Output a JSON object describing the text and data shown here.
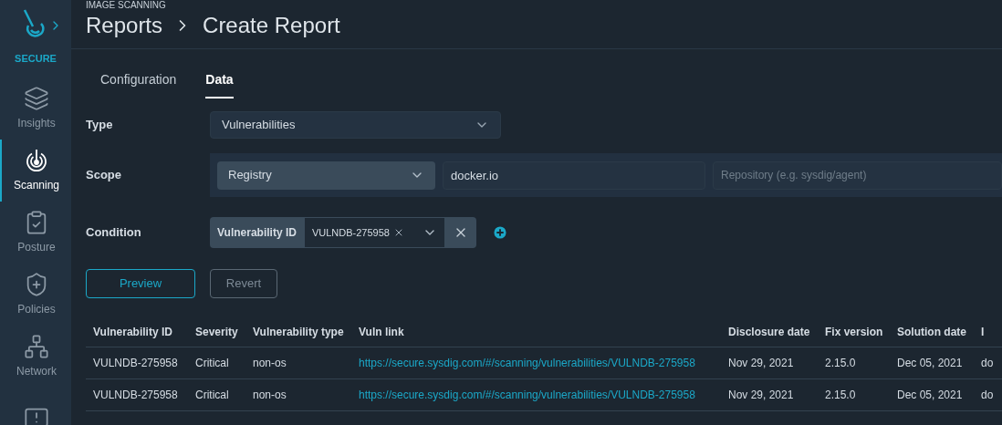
{
  "sidebar": {
    "brand": "SECURE",
    "items": [
      {
        "label": "Insights",
        "kind": "layers",
        "selected": false
      },
      {
        "label": "Scanning",
        "kind": "scan",
        "selected": true
      },
      {
        "label": "Posture",
        "kind": "clipboard",
        "selected": false
      },
      {
        "label": "Policies",
        "kind": "shield",
        "selected": false
      },
      {
        "label": "Network",
        "kind": "network",
        "selected": false
      },
      {
        "kind": "chat",
        "selected": false
      }
    ]
  },
  "header": {
    "section": "IMAGE SCANNING",
    "breadcrumb": [
      "Reports",
      "Create Report"
    ]
  },
  "tabs": [
    {
      "label": "Configuration",
      "selected": false
    },
    {
      "label": "Data",
      "selected": true
    }
  ],
  "form": {
    "type": {
      "label": "Type",
      "value": "Vulnerabilities"
    },
    "scope": {
      "label": "Scope",
      "selector": "Registry",
      "value": "docker.io",
      "placeholder": "Repository (e.g. sysdig/agent)"
    },
    "condition": {
      "label": "Condition",
      "field": "Vulnerability ID",
      "tag": "VULNDB-275958"
    }
  },
  "buttons": [
    {
      "label": "Preview",
      "kind": "primary"
    },
    {
      "label": "Revert",
      "kind": "secondary"
    }
  ],
  "table": {
    "columns": [
      "Vulnerability ID",
      "Severity",
      "Vulnerability type",
      "Vuln link",
      "Disclosure date",
      "Fix version",
      "Solution date",
      "I"
    ],
    "rows": [
      [
        "VULNDB-275958",
        "Critical",
        "non-os",
        "https://secure.sysdig.com/#/scanning/vulnerabilities/VULNDB-275958",
        "Nov 29, 2021",
        "2.15.0",
        "Dec 05, 2021",
        "do"
      ],
      [
        "VULNDB-275958",
        "Critical",
        "non-os",
        "https://secure.sysdig.com/#/scanning/vulnerabilities/VULNDB-275958",
        "Nov 29, 2021",
        "2.15.0",
        "Dec 05, 2021",
        "do"
      ]
    ]
  }
}
